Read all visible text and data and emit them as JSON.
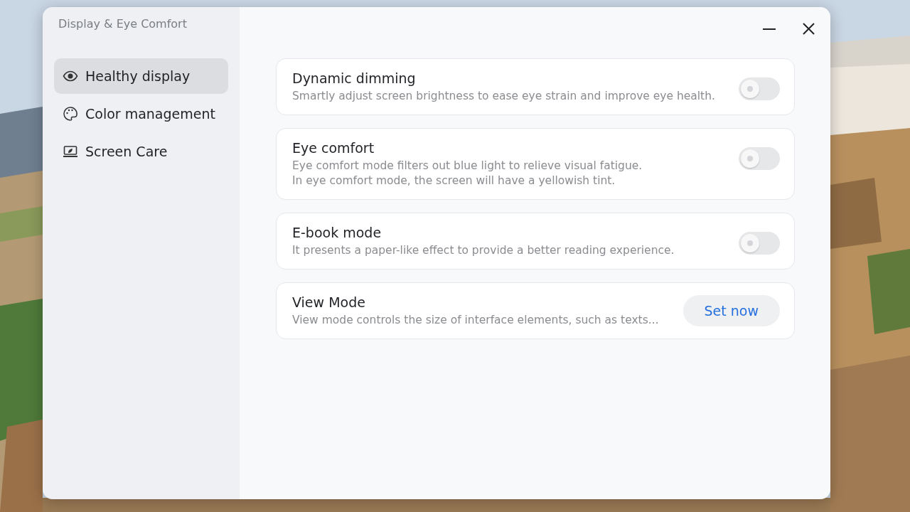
{
  "window": {
    "title": "Display & Eye Comfort"
  },
  "sidebar": {
    "items": [
      {
        "label": "Healthy display",
        "selected": true
      },
      {
        "label": "Color management",
        "selected": false
      },
      {
        "label": "Screen Care",
        "selected": false
      }
    ]
  },
  "settings": [
    {
      "kind": "toggle",
      "title": "Dynamic dimming",
      "description": [
        "Smartly adjust screen brightness to ease eye strain and improve eye health."
      ],
      "on": false
    },
    {
      "kind": "toggle",
      "title": "Eye comfort",
      "description": [
        "Eye comfort mode filters out blue light to relieve visual fatigue.",
        "In eye comfort mode, the screen will have a yellowish tint."
      ],
      "on": false
    },
    {
      "kind": "toggle",
      "title": "E-book mode",
      "description": [
        "It presents a paper-like effect to provide a better reading experience."
      ],
      "on": false
    },
    {
      "kind": "button",
      "title": "View Mode",
      "description": [
        "View mode controls the size of interface elements, such as texts..."
      ],
      "button": "Set now"
    }
  ]
}
